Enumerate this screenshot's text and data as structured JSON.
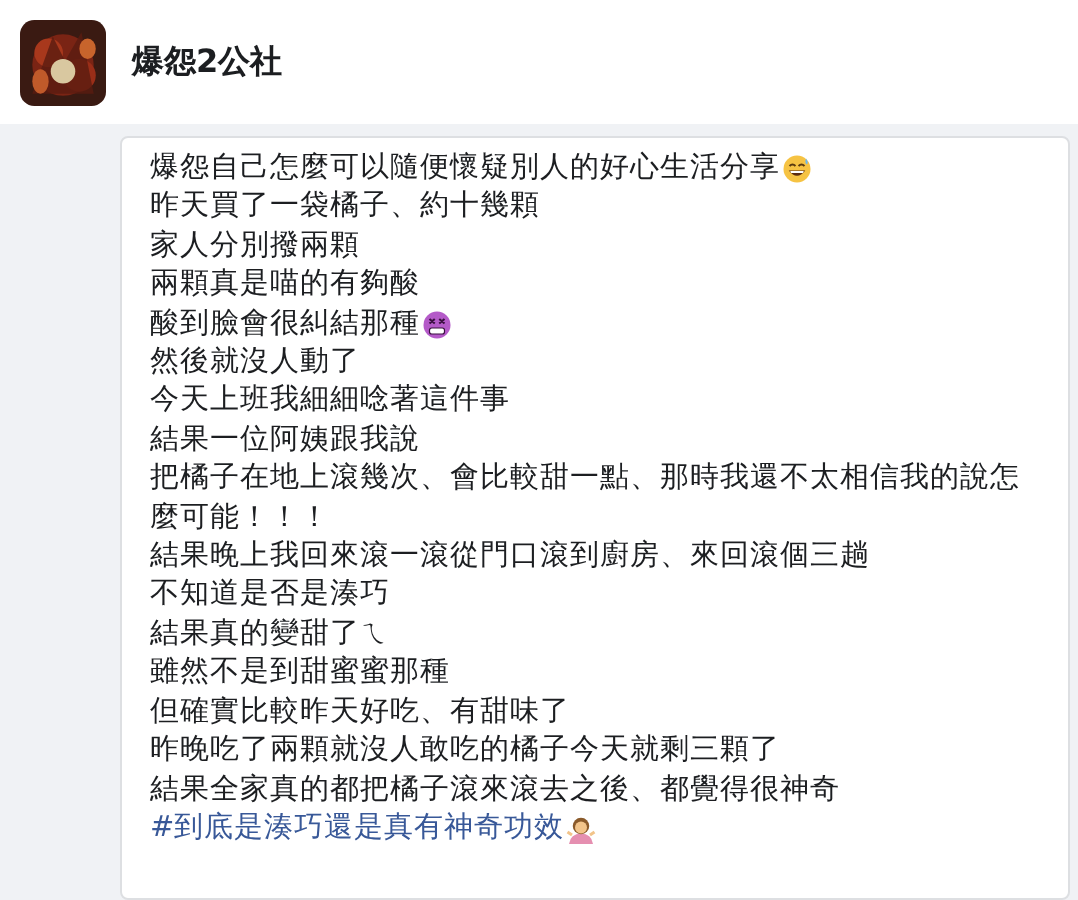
{
  "header": {
    "page_name": "爆怨2公社"
  },
  "post": {
    "lines": [
      {
        "kind": "plain",
        "text": "爆怨自己怎麼可以隨便懷疑別人的好心生活分享",
        "emoji": true
      },
      {
        "kind": "plain",
        "text": "昨天買了一袋橘子、約十幾顆"
      },
      {
        "kind": "plain",
        "text": "家人分別撥兩顆"
      },
      {
        "kind": "plain",
        "text": "兩顆真是喵的有夠酸"
      },
      {
        "kind": "plain",
        "text": "酸到臉會很糾結那種",
        "emoji": true
      },
      {
        "kind": "plain",
        "text": "然後就沒人動了"
      },
      {
        "kind": "plain",
        "text": "今天上班我細細唸著這件事"
      },
      {
        "kind": "plain",
        "text": "結果一位阿姨跟我說"
      },
      {
        "kind": "plain",
        "text": "把橘子在地上滾幾次、會比較甜一點、那時我還不太相信我的說怎麼可能！！！"
      },
      {
        "kind": "plain",
        "text": "結果晚上我回來滾一滾從門口滾到廚房、來回滾個三趟"
      },
      {
        "kind": "plain",
        "text": "不知道是否是湊巧"
      },
      {
        "kind": "plain",
        "text": "結果真的變甜了ㄟ"
      },
      {
        "kind": "plain",
        "text": "雖然不是到甜蜜蜜那種"
      },
      {
        "kind": "plain",
        "text": "但確實比較昨天好吃、有甜味了"
      },
      {
        "kind": "plain",
        "text": "昨晚吃了兩顆就沒人敢吃的橘子今天就剩三顆了"
      },
      {
        "kind": "plain",
        "text": "結果全家真的都把橘子滾來滾去之後、都覺得很神奇"
      },
      {
        "kind": "hashtag",
        "text": "#到底是湊巧還是真有神奇功效",
        "emoji": true
      }
    ]
  }
}
